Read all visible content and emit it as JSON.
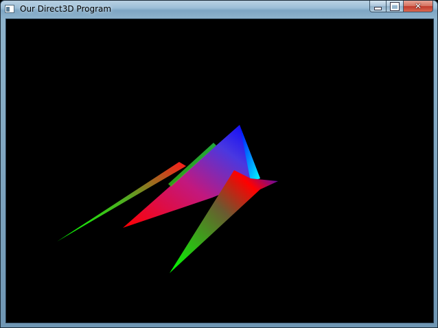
{
  "window": {
    "title": "Our Direct3D Program",
    "buttons": {
      "minimize": "minimize",
      "maximize": "maximize",
      "close": "close"
    }
  },
  "scene": {
    "background": "#000000",
    "colors": {
      "red": "#ff0000",
      "green": "#00ff00",
      "blue": "#0000ff",
      "cyan": "#00ffff",
      "magenta": "#c0208a"
    }
  }
}
